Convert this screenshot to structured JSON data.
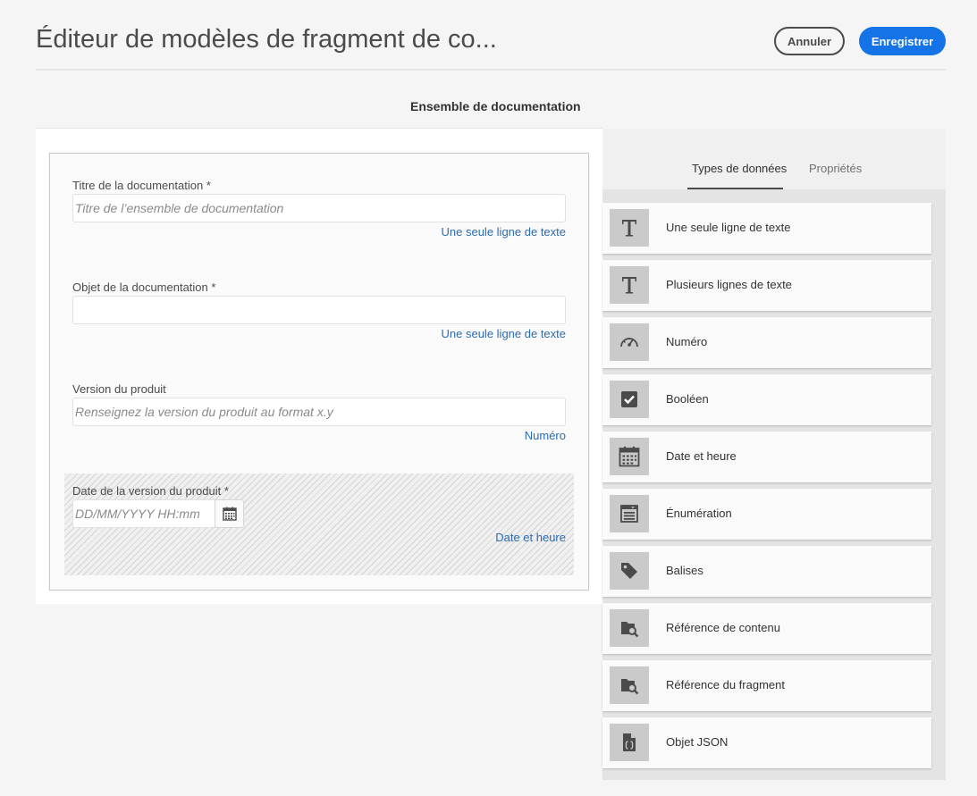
{
  "header": {
    "title": "Éditeur de modèles de fragment de co...",
    "cancel_label": "Annuler",
    "save_label": "Enregistrer"
  },
  "section_title": "Ensemble de documentation",
  "form": {
    "fields": [
      {
        "label": "Titre de la documentation *",
        "placeholder": "Titre de l’ensemble de documentation",
        "value": "",
        "type_label": "Une seule ligne de texte"
      },
      {
        "label": "Objet de la documentation *",
        "placeholder": "",
        "value": "",
        "type_label": "Une seule ligne de texte"
      },
      {
        "label": "Version du produit",
        "placeholder": "Renseignez la version du produit au format x.y",
        "value": "",
        "type_label": "Numéro"
      },
      {
        "label": "Date de la version du produit *",
        "placeholder": "DD/MM/YYYY HH:mm",
        "value": "",
        "type_label": "Date et heure"
      }
    ]
  },
  "sidebar": {
    "tabs": [
      {
        "label": "Types de données",
        "active": true
      },
      {
        "label": "Propriétés",
        "active": false
      }
    ],
    "data_types": [
      {
        "label": "Une seule ligne de texte",
        "icon": "text-icon"
      },
      {
        "label": "Plusieurs lignes de texte",
        "icon": "text-icon"
      },
      {
        "label": "Numéro",
        "icon": "gauge-icon"
      },
      {
        "label": "Booléen",
        "icon": "checkbox-icon"
      },
      {
        "label": "Date et heure",
        "icon": "calendar-icon"
      },
      {
        "label": "Énumération",
        "icon": "list-icon"
      },
      {
        "label": "Balises",
        "icon": "tag-icon"
      },
      {
        "label": "Référence de contenu",
        "icon": "folder-search-icon"
      },
      {
        "label": "Référence du fragment",
        "icon": "folder-search-icon"
      },
      {
        "label": "Objet JSON",
        "icon": "json-file-icon"
      }
    ]
  },
  "colors": {
    "accent": "#1473e6",
    "link": "#2d6bb2"
  }
}
